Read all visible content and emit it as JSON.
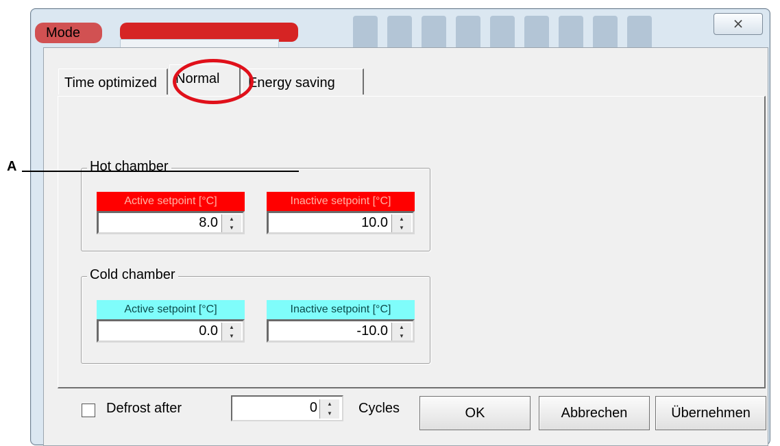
{
  "window": {
    "title": "Mode",
    "close_glyph": "⨯"
  },
  "tabs": [
    {
      "label": "Time optimized",
      "selected": false
    },
    {
      "label": "Normal",
      "selected": true
    },
    {
      "label": "Energy saving",
      "selected": false
    }
  ],
  "hot_chamber": {
    "title": "Hot chamber",
    "color": "#ff0000",
    "active_label": "Active setpoint [°C]",
    "active_value": "8.0",
    "inactive_label": "Inactive setpoint [°C]",
    "inactive_value": "10.0"
  },
  "cold_chamber": {
    "title": "Cold chamber",
    "color": "#7ffdfb",
    "active_label": "Active setpoint [°C]",
    "active_value": "0.0",
    "inactive_label": "Inactive setpoint [°C]",
    "inactive_value": "-10.0"
  },
  "defrost": {
    "checked": false,
    "label": "Defrost after",
    "value": "0",
    "unit_label": "Cycles"
  },
  "buttons": {
    "ok": "OK",
    "cancel": "Abbrechen",
    "apply": "Übernehmen"
  },
  "annotation": {
    "letter": "A"
  },
  "colors": {
    "highlight": "#e0101a"
  },
  "icons": {
    "spin_up": "up-arrow-icon",
    "spin_down": "down-arrow-icon"
  }
}
